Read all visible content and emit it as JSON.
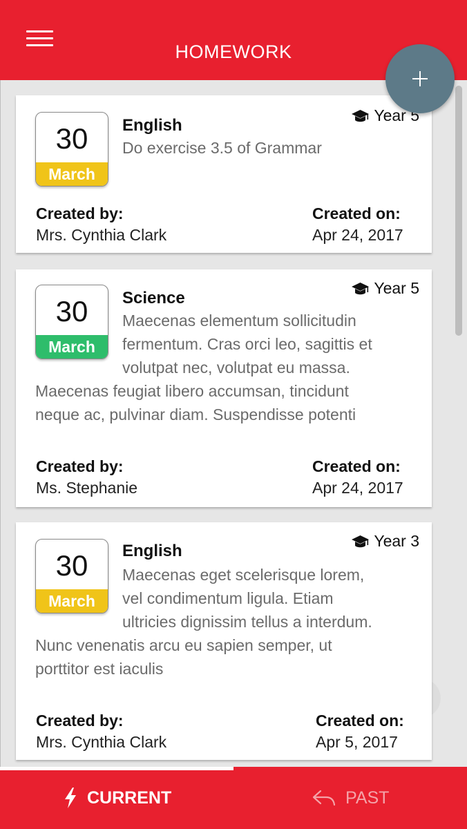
{
  "header": {
    "title": "HOMEWORK"
  },
  "icons": {
    "menu": "menu-icon",
    "add": "plus-icon",
    "cap": "graduation-cap-icon",
    "current": "lightning-icon",
    "past": "reply-arrow-icon"
  },
  "colors": {
    "header": "#e8202f",
    "fab": "#5d7a88",
    "month_yellow": "#f0c419",
    "month_green": "#2ebd6b"
  },
  "cards": [
    {
      "day": "30",
      "month": "March",
      "subject": "English",
      "year": "Year 5",
      "desc_lines": [
        "Do exercise 3.5 of Grammar"
      ],
      "created_by_label": "Created by:",
      "created_by": "Mrs. Cynthia Clark",
      "created_on_label": "Created on:",
      "created_on": "Apr 24, 2017"
    },
    {
      "day": "30",
      "month": "March",
      "subject": "Science",
      "year": "Year 5",
      "desc_lines": [
        "Maecenas elementum sollicitudin",
        "fermentum. Cras orci leo, sagittis et",
        "volutpat nec, volutpat eu massa.",
        "Maecenas feugiat libero accumsan, tincidunt",
        "neque ac, pulvinar diam. Suspendisse potenti"
      ],
      "created_by_label": "Created by:",
      "created_by": "Ms. Stephanie",
      "created_on_label": "Created on:",
      "created_on": "Apr 24, 2017"
    },
    {
      "day": "30",
      "month": "March",
      "subject": "English",
      "year": "Year 3",
      "desc_lines": [
        "Maecenas eget scelerisque lorem,",
        "vel condimentum ligula. Etiam",
        "ultricies dignissim tellus a interdum.",
        "Nunc venenatis arcu eu sapien semper, ut",
        "porttitor est iaculis"
      ],
      "created_by_label": "Created by:",
      "created_by": "Mrs. Cynthia Clark",
      "created_on_label": "Created on:",
      "created_on": "Apr 5, 2017"
    }
  ],
  "tabs": {
    "current": "CURRENT",
    "past": "PAST"
  }
}
